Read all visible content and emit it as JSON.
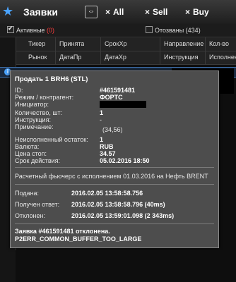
{
  "toolbar": {
    "title": "Заявки",
    "filters": [
      "All",
      "Sell",
      "Buy"
    ]
  },
  "tabs": {
    "active_label": "Активные",
    "active_count": "(0)",
    "revoked_label": "Отозваны (434)"
  },
  "grid": {
    "header_row1": [
      "Тикер",
      "Принята",
      "СрокХр",
      "Направление",
      "Кол-во"
    ],
    "header_row2": [
      "Рынок",
      "ДатаПр",
      "ДатаХр",
      "Инструкция",
      "Исполнен"
    ]
  },
  "popup": {
    "title": "Продать 1 BRH6 (STL)",
    "fields": [
      {
        "label": "ID:",
        "value": "#461591481"
      },
      {
        "label": "Режим / контрагент:",
        "value": "ФОРТС"
      },
      {
        "label": "Инициатор:",
        "value": ""
      },
      {
        "label": "Количество, шт:",
        "value": "1"
      },
      {
        "label": "Инструкция:",
        "value": "-"
      },
      {
        "label": "Примечание:",
        "value": "(34,56)"
      },
      {
        "label": "Неисполненный остаток:",
        "value": "1"
      },
      {
        "label": "Валюта:",
        "value": "RUB"
      },
      {
        "label": "Цена стоп:",
        "value": "34.57"
      },
      {
        "label": "Срок действия:",
        "value": "05.02.2016  18:50"
      }
    ],
    "description": "Расчетный фьючерс с исполнением 01.03.2016 на Нефть  BRENT",
    "times": [
      {
        "label": "Подана:",
        "value": "2016.02.05  13:58:58.756"
      },
      {
        "label": "Получен ответ:",
        "value": "2016.02.05  13:58:58.796 (40ms)"
      },
      {
        "label": "Отклонен:",
        "value": "2016.02.05  13:59:01.098 (2 343ms)"
      }
    ],
    "footer_line1": "Заявка #461591481 отклонена.",
    "footer_line2": "P2ERR_COMMON_BUFFER_TOO_LARGE"
  },
  "colors": {
    "accent_blue": "#4aa3ff",
    "count_red": "#ff3c3c"
  }
}
